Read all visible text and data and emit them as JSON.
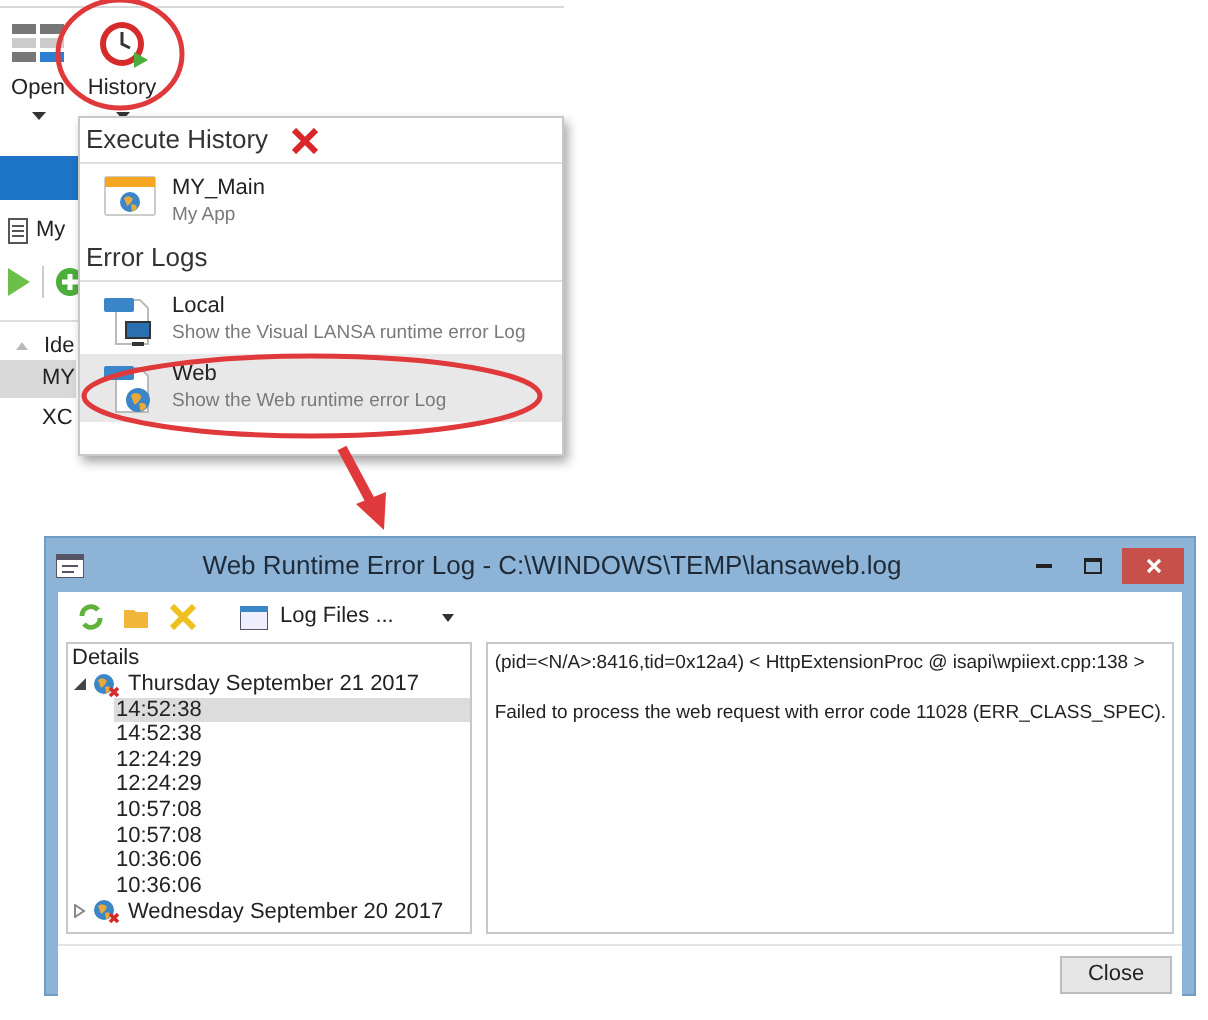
{
  "app": {
    "ribbon_buttons": [
      {
        "label": "Open",
        "kind": "grid"
      },
      {
        "label": "History",
        "kind": "clock"
      }
    ],
    "tab_label": "My",
    "column_header": "Ide",
    "rows": [
      {
        "text": "MY",
        "selected": true
      },
      {
        "text": "XC",
        "selected": false
      }
    ]
  },
  "menu": {
    "sections": [
      {
        "title": "Execute History",
        "clear_icon": true,
        "items": [
          {
            "title": "MY_Main",
            "subtitle": "My App",
            "kind": "app",
            "selected": false
          }
        ]
      },
      {
        "title": "Error Logs",
        "clear_icon": false,
        "items": [
          {
            "title": "Local",
            "subtitle": "Show the Visual LANSA runtime error Log",
            "kind": "local",
            "selected": false
          },
          {
            "title": "Web",
            "subtitle": "Show the Web runtime error Log",
            "kind": "web",
            "selected": true
          }
        ]
      }
    ]
  },
  "window": {
    "title": "Web Runtime Error Log - C:\\WINDOWS\\TEMP\\lansaweb.log",
    "log_files": "Log Files ...",
    "tree": {
      "header": "Details",
      "nodes": [
        {
          "label": "Thursday September 21 2017",
          "expanded": true,
          "selected": false,
          "children": [
            {
              "label": "14:52:38",
              "selected": true
            },
            {
              "label": "14:52:38",
              "selected": false
            },
            {
              "label": "12:24:29",
              "selected": false
            },
            {
              "label": "12:24:29",
              "selected": false
            },
            {
              "label": "10:57:08",
              "selected": false
            },
            {
              "label": "10:57:08",
              "selected": false
            },
            {
              "label": "10:36:06",
              "selected": false
            },
            {
              "label": "10:36:06",
              "selected": false
            }
          ]
        },
        {
          "label": "Wednesday September 20 2017",
          "expanded": false,
          "selected": false
        }
      ]
    },
    "detail_lines": [
      "(pid=<N/A>:8416,tid=0x12a4) < HttpExtensionProc @ isapi\\wpiiext.cpp:138 >",
      "Failed to process the web request with error code 11028 (ERR_CLASS_SPEC)."
    ],
    "close_button": "Close"
  }
}
